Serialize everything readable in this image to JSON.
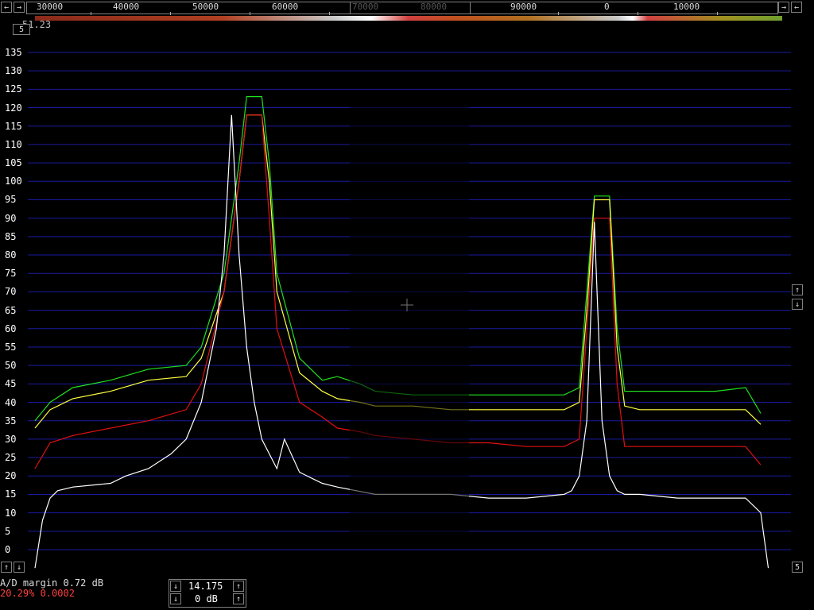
{
  "top_scale": {
    "left_labels": [
      "30000",
      "40000",
      "50000",
      "60000",
      "70000",
      "80000",
      "90000"
    ],
    "right_labels": [
      "0",
      "10000"
    ]
  },
  "corner_readout": "51.23",
  "corner_box": "5",
  "y_axis": {
    "ticks": [
      "135",
      "130",
      "125",
      "120",
      "115",
      "110",
      "105",
      "100",
      "95",
      "90",
      "85",
      "80",
      "75",
      "70",
      "65",
      "60",
      "55",
      "50",
      "45",
      "40",
      "35",
      "30",
      "25",
      "20",
      "15",
      "10",
      "5",
      "0"
    ]
  },
  "buttons": {
    "scale_left": "←",
    "scale_right": "→",
    "scale_left2": "←",
    "scale_right2": "→",
    "bottom_up": "↑",
    "bottom_down": "↓",
    "right_up": "↑",
    "right_down": "↓",
    "right_value": "5",
    "freq_down": "↓",
    "freq_up": "↑",
    "gain_down": "↓",
    "gain_up": "↑"
  },
  "status": {
    "ad_margin": "A/D margin  0.72 dB",
    "load": "20.29% 0.0002"
  },
  "frequency": "14.175",
  "gain": "0 dB",
  "colors": {
    "grid": "#1a1aa0",
    "white_trace": "#ffffff",
    "red_trace": "#e01010",
    "yellow_trace": "#ffff40",
    "green_trace": "#20e020"
  },
  "chart_data": {
    "type": "line",
    "ylim": [
      -5,
      139
    ],
    "yticks": [
      0,
      5,
      10,
      15,
      20,
      25,
      30,
      35,
      40,
      45,
      50,
      55,
      60,
      65,
      70,
      75,
      80,
      85,
      90,
      95,
      100,
      105,
      110,
      115,
      120,
      125,
      130,
      135
    ],
    "xlim": [
      0,
      100
    ],
    "series": [
      {
        "color": "#20e020",
        "x": [
          0,
          2,
          5,
          10,
          15,
          20,
          22,
          25,
          27,
          28,
          29,
          30,
          31,
          32,
          35,
          38,
          40,
          43,
          45,
          50,
          55,
          60,
          65,
          70,
          72,
          73,
          74,
          75,
          76,
          77,
          78,
          80,
          85,
          90,
          94,
          96
        ],
        "y": [
          35,
          40,
          44,
          46,
          49,
          50,
          55,
          75,
          105,
          123,
          123,
          123,
          105,
          75,
          52,
          46,
          47,
          45,
          43,
          42,
          42,
          42,
          42,
          42,
          44,
          70,
          96,
          96,
          96,
          60,
          43,
          43,
          43,
          43,
          44,
          37
        ]
      },
      {
        "color": "#ffff40",
        "x": [
          0,
          2,
          5,
          10,
          15,
          20,
          22,
          25,
          27,
          28,
          29,
          30,
          31,
          32,
          35,
          38,
          40,
          43,
          45,
          50,
          55,
          60,
          65,
          70,
          72,
          73,
          74,
          75,
          76,
          77,
          78,
          80,
          85,
          90,
          94,
          96
        ],
        "y": [
          33,
          38,
          41,
          43,
          46,
          47,
          52,
          70,
          100,
          118,
          118,
          118,
          100,
          70,
          48,
          43,
          41,
          40,
          39,
          39,
          38,
          38,
          38,
          38,
          40,
          65,
          95,
          95,
          95,
          55,
          39,
          38,
          38,
          38,
          38,
          34
        ]
      },
      {
        "color": "#e01010",
        "x": [
          0,
          2,
          5,
          10,
          15,
          20,
          22,
          25,
          27,
          28,
          29,
          30,
          31,
          32,
          35,
          38,
          40,
          43,
          45,
          50,
          55,
          60,
          65,
          70,
          72,
          73,
          74,
          75,
          76,
          77,
          78,
          80,
          85,
          90,
          94,
          96
        ],
        "y": [
          22,
          29,
          31,
          33,
          35,
          38,
          45,
          70,
          100,
          118,
          118,
          118,
          90,
          60,
          40,
          36,
          33,
          32,
          31,
          30,
          29,
          29,
          28,
          28,
          30,
          60,
          90,
          90,
          90,
          45,
          28,
          28,
          28,
          28,
          28,
          23
        ]
      },
      {
        "color": "#ffffff",
        "x": [
          0,
          1,
          2,
          3,
          5,
          10,
          12,
          15,
          18,
          20,
          22,
          24,
          25,
          26,
          27,
          28,
          29,
          30,
          32,
          33,
          35,
          37,
          38,
          40,
          45,
          50,
          55,
          60,
          65,
          70,
          71,
          72,
          73,
          74,
          75,
          76,
          77,
          78,
          80,
          85,
          90,
          94,
          96,
          97
        ],
        "y": [
          -5,
          8,
          14,
          16,
          17,
          18,
          20,
          22,
          26,
          30,
          40,
          60,
          80,
          118,
          80,
          55,
          40,
          30,
          22,
          30,
          21,
          19,
          18,
          17,
          15,
          15,
          15,
          14,
          14,
          15,
          16,
          20,
          35,
          89,
          35,
          20,
          16,
          15,
          15,
          14,
          14,
          14,
          10,
          -5
        ]
      }
    ]
  }
}
